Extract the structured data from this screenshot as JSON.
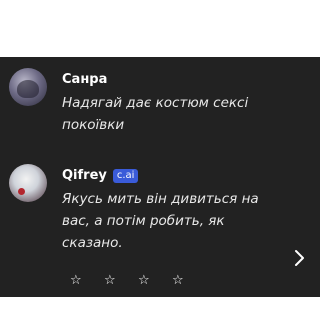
{
  "messages": [
    {
      "author": "Санра",
      "avatar": "character-avatar",
      "text": "Надягай дає костюм сексі покоївки"
    },
    {
      "author": "Qifrey",
      "badge": "c.ai",
      "avatar": "character-avatar",
      "text": "Якусь мить він дивиться на вас, а потім робить, як сказано."
    }
  ],
  "rating": {
    "glyph": "☆",
    "stars_total": 5,
    "value": 0
  },
  "icons": {
    "next": "chevron-right-icon",
    "star": "star-outline-icon"
  },
  "colors": {
    "panel_bg": "#222222",
    "text": "#e8e8e8",
    "badge": "#3a5bd9"
  }
}
